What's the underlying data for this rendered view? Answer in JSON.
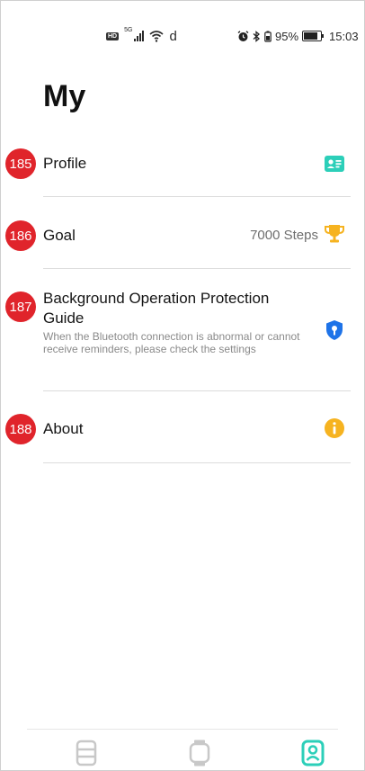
{
  "status_bar": {
    "hd_badge": "HD",
    "network_type": "5G",
    "carrier_glyph": "d",
    "battery_percent": "95%",
    "battery_level": 0.95,
    "time": "15:03"
  },
  "page": {
    "title": "My"
  },
  "menu": {
    "profile": {
      "badge": "185",
      "label": "Profile",
      "icon": "contact-card-icon",
      "color": "#2ccfb9"
    },
    "goal": {
      "badge": "186",
      "label": "Goal",
      "value": "7000 Steps",
      "icon": "trophy-icon",
      "color": "#f6b320"
    },
    "protection": {
      "badge": "187",
      "label_line1": "Background Operation Protection",
      "label_line2": "Guide",
      "description": "When the Bluetooth connection is abnormal or cannot receive reminders, please check the settings",
      "icon": "shield-icon",
      "color": "#1e73e8"
    },
    "about": {
      "badge": "188",
      "label": "About",
      "icon": "info-icon",
      "color": "#f6b320"
    }
  },
  "tabbar": {
    "tabs": [
      {
        "icon": "data-tab-icon",
        "active": false
      },
      {
        "icon": "watch-tab-icon",
        "active": false
      },
      {
        "icon": "profile-tab-icon",
        "active": true
      }
    ],
    "active_color": "#2ccfb9",
    "inactive_color": "#c8c8c8"
  }
}
